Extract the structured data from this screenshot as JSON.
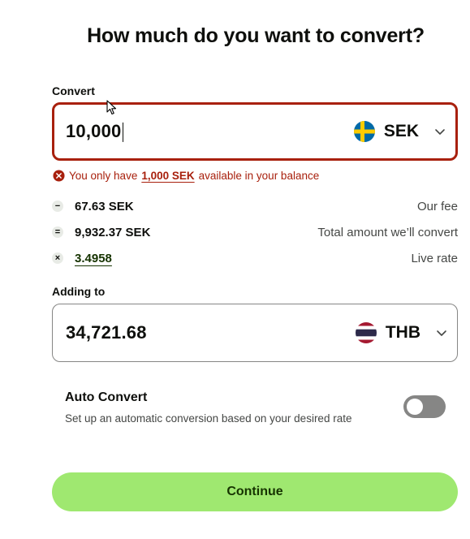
{
  "page": {
    "title": "How much do you want to convert?"
  },
  "convert": {
    "label": "Convert",
    "amount": "10,000",
    "currency": "SEK",
    "flag_icon": "sweden-flag-icon"
  },
  "error": {
    "prefix": "You only have",
    "amount": "1,000 SEK",
    "suffix": "available in your balance"
  },
  "breakdown": {
    "fee": {
      "symbol": "−",
      "value": "67.63 SEK",
      "label": "Our fee"
    },
    "total": {
      "symbol": "=",
      "value": "9,932.37 SEK",
      "label": "Total amount we’ll convert"
    },
    "rate": {
      "symbol": "×",
      "value": "3.4958",
      "label": "Live rate"
    }
  },
  "adding": {
    "label": "Adding to",
    "amount": "34,721.68",
    "currency": "THB",
    "flag_icon": "thailand-flag-icon"
  },
  "auto_convert": {
    "title": "Auto Convert",
    "description": "Set up an automatic conversion based on your desired rate",
    "enabled": false
  },
  "actions": {
    "continue_label": "Continue"
  },
  "colors": {
    "accent": "#9fe870",
    "accent_text": "#163300",
    "error": "#a8200d",
    "text": "#0e0f0c",
    "muted": "#454745"
  }
}
